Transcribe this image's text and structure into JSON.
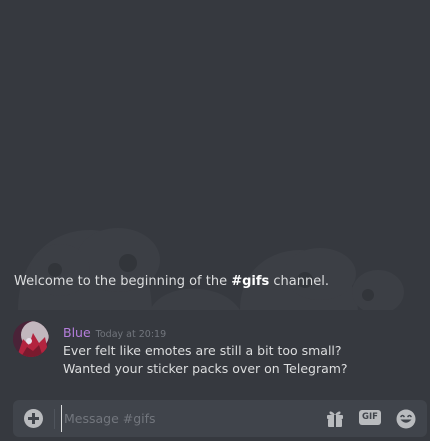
{
  "colors": {
    "background": "#36393f",
    "composer_background": "#40444b",
    "username": "#b57edc",
    "text": "#dcddde",
    "muted": "#72767d",
    "icon": "#b9bbbe"
  },
  "welcome": {
    "prefix": "Welcome to the beginning of the ",
    "channel": "#gifs",
    "suffix": " channel."
  },
  "message": {
    "author": "Blue",
    "timestamp": "Today at 20:19",
    "lines": [
      "Ever felt like emotes are still a bit too small?",
      "Wanted your sticker packs over on Telegram?"
    ]
  },
  "composer": {
    "placeholder": "Message #gifs",
    "value": "",
    "gif_label": "GIF",
    "icons": {
      "upload": "plus-circle-icon",
      "gift": "gift-icon",
      "gif": "gif-icon",
      "emoji": "emoji-icon"
    }
  }
}
